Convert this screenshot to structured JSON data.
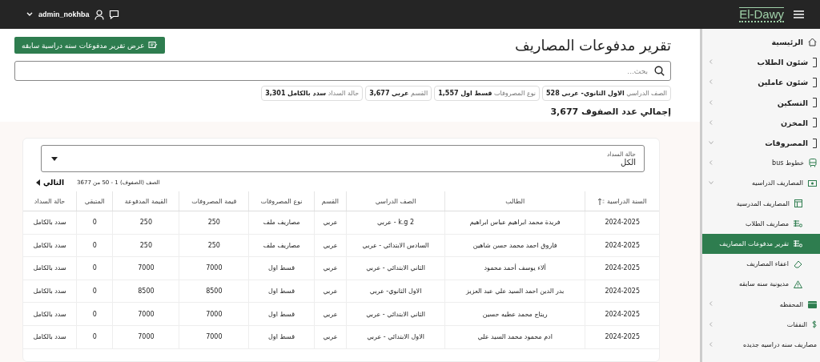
{
  "topbar": {
    "username": "admin_nokhba",
    "logo": "El-Dawy"
  },
  "sidebar": {
    "items": [
      {
        "label": "الرئيسية",
        "kind": "home",
        "selected": false
      },
      {
        "label": "شئون الطلاب",
        "kind": "section",
        "selected": false,
        "expanded": false
      },
      {
        "label": "شئون عاملين",
        "kind": "section",
        "selected": false,
        "expanded": false
      },
      {
        "label": "التسكين",
        "kind": "section",
        "selected": false,
        "expanded": false
      },
      {
        "label": "المخزن",
        "kind": "section",
        "selected": false,
        "expanded": false
      },
      {
        "label": "المصروفات",
        "kind": "section",
        "selected": false,
        "expanded": true,
        "children": [
          {
            "label": "خطوط bus",
            "selected": false,
            "expanded": false
          },
          {
            "label": "المصاريف الدراسيه",
            "selected": false,
            "expanded": true,
            "children": [
              {
                "label": "المصاريف المدرسية",
                "selected": false
              },
              {
                "label": "مصاريف الطلاب",
                "selected": false
              },
              {
                "label": "تقرير مدفوعات المصاريف",
                "selected": true
              },
              {
                "label": "اعفاء المصاريف",
                "selected": false
              },
              {
                "label": "مديونية سنه سابقه",
                "selected": false
              }
            ]
          },
          {
            "label": "المحفظه",
            "selected": false,
            "expanded": false
          },
          {
            "label": "النفقات",
            "selected": false,
            "expanded": false
          },
          {
            "label": "مصاريف سنه دراسيه جديده",
            "selected": false,
            "expanded": false
          }
        ]
      }
    ]
  },
  "page": {
    "title": "تقرير مدفوعات المصاريف",
    "action_button": "عرض تقرير مدفوعات سنه دراسية سابقه",
    "search": {
      "placeholder": "بحث..."
    },
    "chips": [
      {
        "label": "الصف الدراسي",
        "value": "الاول الثانوي- عربي",
        "count": "528"
      },
      {
        "label": "نوع المصروفات",
        "value": "قسط اول",
        "count": "1,557"
      },
      {
        "label": "القسم",
        "value": "عربي",
        "count": "3,677"
      },
      {
        "label": "حالة السداد",
        "value": "سدد بالكامل",
        "count": "3,301"
      }
    ],
    "total": "إجمالي عدد الصفوف 3,677"
  },
  "filter": {
    "label": "حالة السداد",
    "value": "الكل"
  },
  "pagination": {
    "range": "الصف (الصفوف) 1 - 50 من 3677",
    "next": "التالي"
  },
  "table": {
    "columns": [
      "السنة الدراسية",
      "الطالب",
      "الصف الدراسي",
      "القسم",
      "نوع المصروفات",
      "قيمة المصروفات",
      "القيمة المدفوعة",
      "المتبقي",
      "حالة السداد"
    ],
    "rows": [
      [
        "2024-2025",
        "فريدة محمد ابراهيم عباس ابراهيم",
        "k.g 2 - عربي",
        "عربي",
        "مصاريف ملف",
        "250",
        "250",
        "0",
        "سدد بالكامل"
      ],
      [
        "2024-2025",
        "فاروق احمد محمد حسن شاهين",
        "السادس الابتدائي - عربي",
        "عربي",
        "مصاريف ملف",
        "250",
        "250",
        "0",
        "سدد بالكامل"
      ],
      [
        "2024-2025",
        "ألاء يوسف أحمد محمود",
        "الثاني الابتدائي - عربي",
        "عربي",
        "قسط اول",
        "7000",
        "7000",
        "0",
        "سدد بالكامل"
      ],
      [
        "2024-2025",
        "بدر الدين احمد السيد علي عبد العزيز",
        "الاول الثانوي- عربي",
        "عربي",
        "قسط اول",
        "8500",
        "8500",
        "0",
        "سدد بالكامل"
      ],
      [
        "2024-2025",
        "ريتاج محمد عطيه حسين",
        "الثاني الابتدائي - عربي",
        "عربي",
        "قسط اول",
        "7000",
        "7000",
        "0",
        "سدد بالكامل"
      ],
      [
        "2024-2025",
        "ادم محمود محمد السيد علي",
        "الاول الابتدائي - عربي",
        "عربي",
        "قسط اول",
        "7000",
        "7000",
        "0",
        "سدد بالكامل"
      ]
    ]
  }
}
